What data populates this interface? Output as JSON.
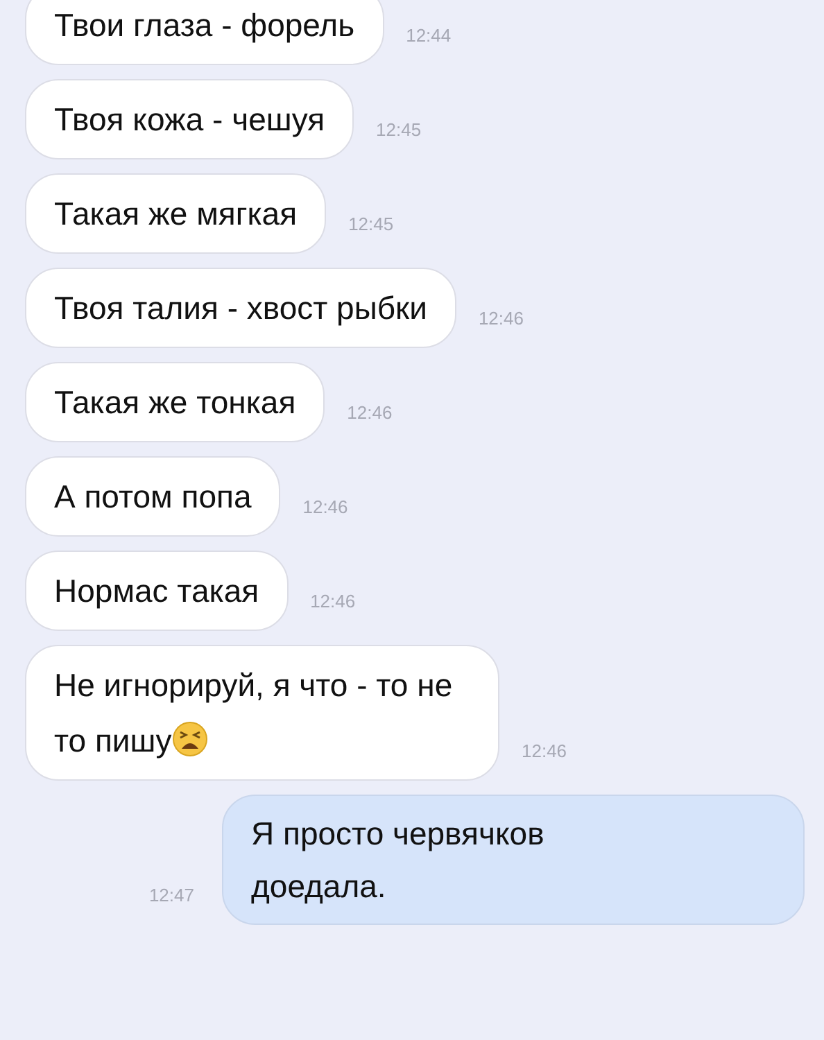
{
  "messages": [
    {
      "kind": "received",
      "text": "Твои глаза - форель",
      "time": "12:44",
      "emoji": false
    },
    {
      "kind": "received",
      "text": "Твоя кожа - чешуя",
      "time": "12:45",
      "emoji": false
    },
    {
      "kind": "received",
      "text": "Такая же мягкая",
      "time": "12:45",
      "emoji": false
    },
    {
      "kind": "received",
      "text": "Твоя талия - хвост рыбки",
      "time": "12:46",
      "emoji": false
    },
    {
      "kind": "received",
      "text": "Такая же тонкая",
      "time": "12:46",
      "emoji": false
    },
    {
      "kind": "received",
      "text": "А потом попа",
      "time": "12:46",
      "emoji": false
    },
    {
      "kind": "received",
      "text": "Нормас такая",
      "time": "12:46",
      "emoji": false
    },
    {
      "kind": "received",
      "text": "Не игнорируй, я что - то не то пишу",
      "time": "12:46",
      "emoji": true
    },
    {
      "kind": "sent",
      "text": "Я просто червячков доедала.",
      "time": "12:47",
      "emoji": false
    }
  ]
}
